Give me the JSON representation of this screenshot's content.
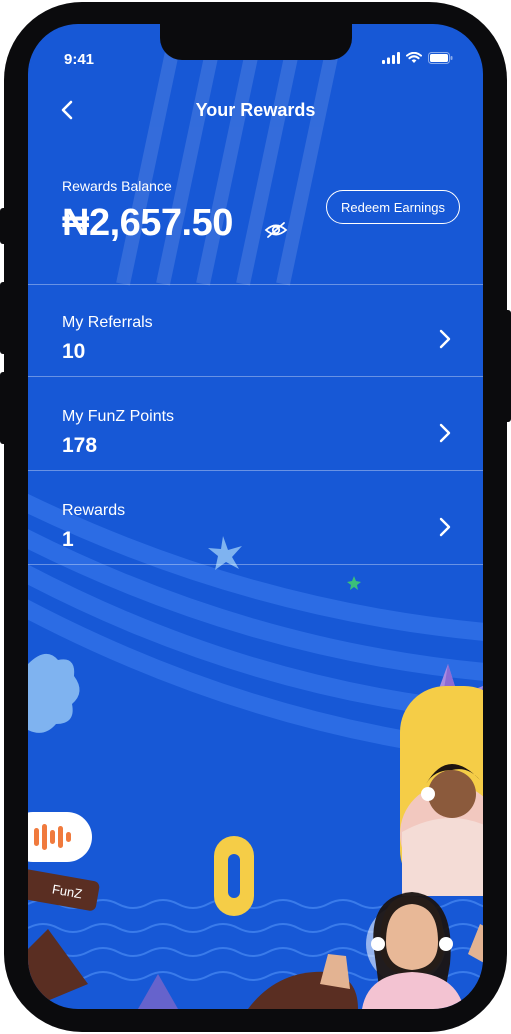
{
  "status_bar": {
    "time": "9:41"
  },
  "header": {
    "title": "Your Rewards"
  },
  "balance": {
    "label": "Rewards Balance",
    "amount": "₦2,657.50",
    "redeem_label": "Redeem Earnings"
  },
  "rows": [
    {
      "label": "My Referrals",
      "value": "10"
    },
    {
      "label": "My FunZ Points",
      "value": "178"
    },
    {
      "label": "Rewards",
      "value": "1"
    }
  ],
  "decor": {
    "tag_text": "FunZ"
  },
  "colors": {
    "background": "#1758d6",
    "accent_yellow": "#f5cd47",
    "accent_light_blue": "#7fb3f0",
    "accent_brown": "#5a2e22",
    "accent_orange": "#f07a3d"
  }
}
